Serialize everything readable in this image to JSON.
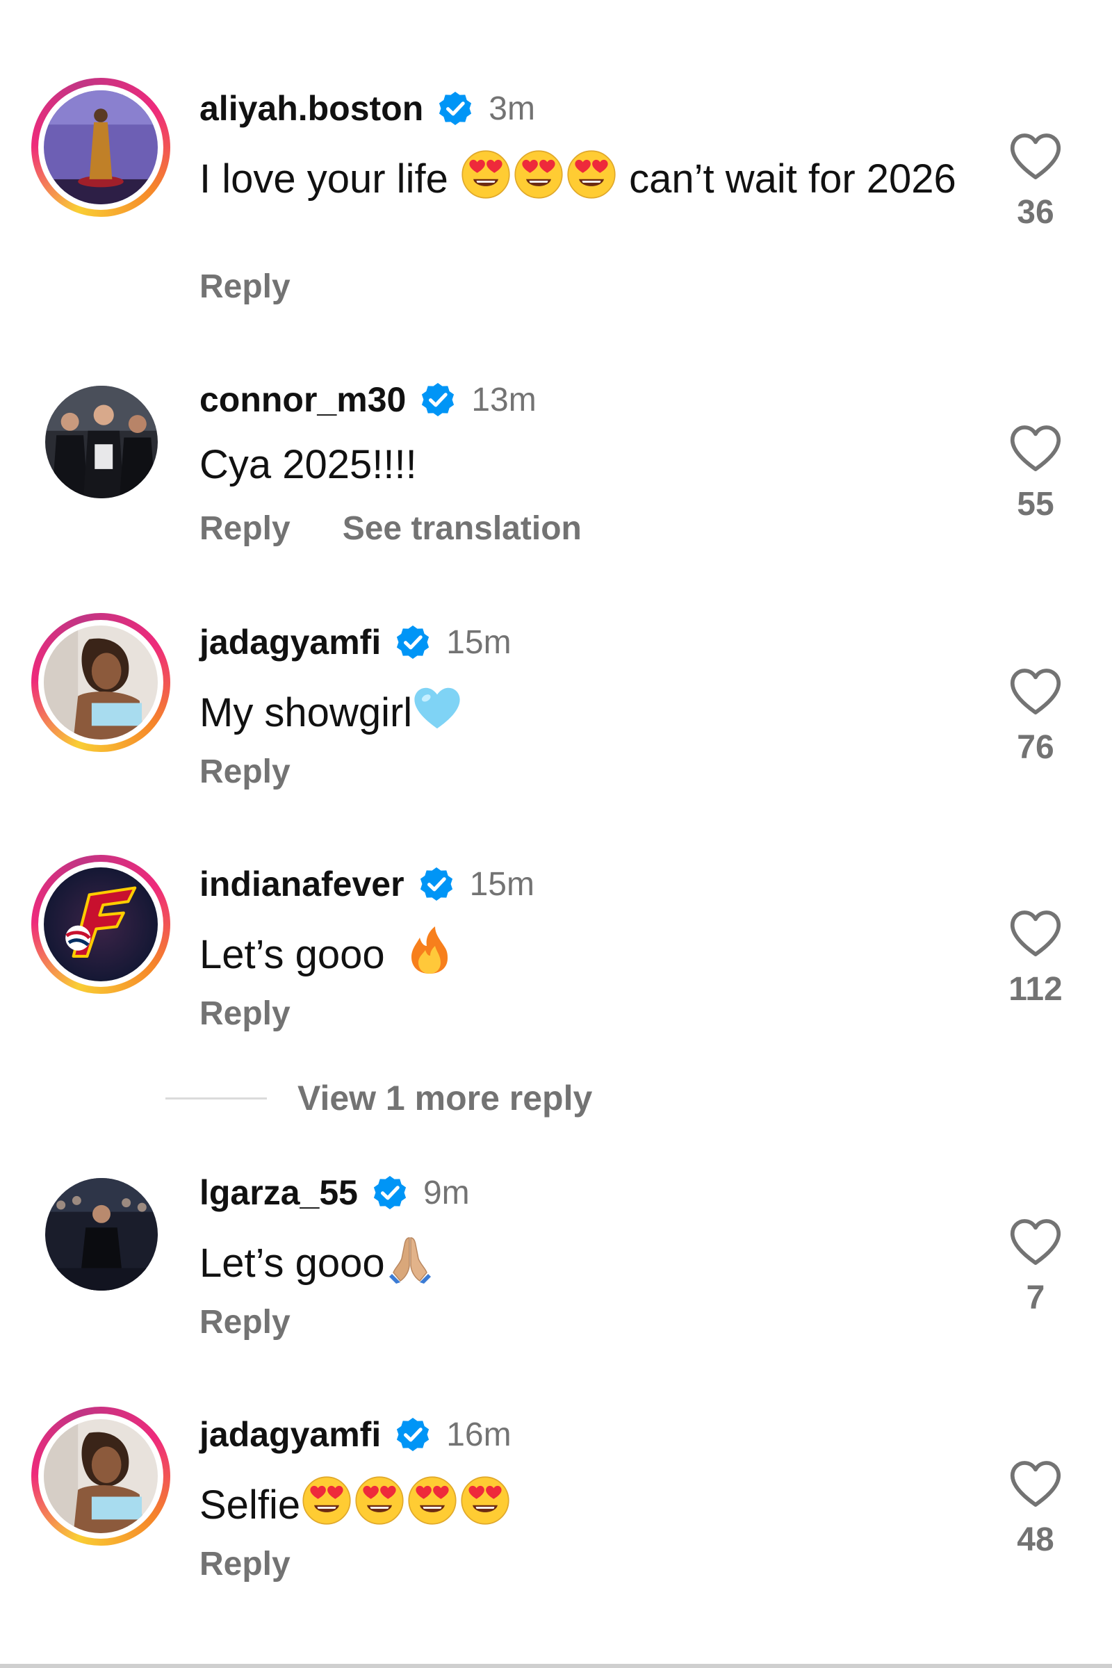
{
  "comments": [
    {
      "username": "aliyah.boston",
      "time": "3m",
      "text_parts": [
        "I love your life ",
        " can’t wait for 2026"
      ],
      "reply_label": "Reply",
      "likes": "36"
    },
    {
      "username": "connor_m30",
      "time": "13m",
      "text": "Cya 2025!!!!",
      "reply_label": "Reply",
      "translation_label": "See translation",
      "likes": "55"
    },
    {
      "username": "jadagyamfi",
      "time": "15m",
      "text": "My showgirl",
      "reply_label": "Reply",
      "likes": "76"
    },
    {
      "username": "indianafever",
      "time": "15m",
      "text": "Let’s gooo",
      "reply_label": "Reply",
      "likes": "112"
    },
    {
      "username": "lgarza_55",
      "time": "9m",
      "text": "Let’s gooo",
      "reply_label": "Reply",
      "likes": "7"
    },
    {
      "username": "jadagyamfi",
      "time": "16m",
      "text": "Selfie",
      "reply_label": "Reply",
      "likes": "48"
    }
  ],
  "view_more_replies": "View 1 more reply",
  "icons": {
    "verified": "verified-badge-icon",
    "like": "heart-outline-icon",
    "emojis": [
      "heart-eyes-emoji",
      "blue-heart-emoji",
      "fire-emoji",
      "folded-hands-emoji"
    ]
  },
  "colors": {
    "verified_blue": "#0095f6",
    "secondary_text": "#737373",
    "story_ring": [
      "#f9ce34",
      "#ee2a7b",
      "#c13584"
    ]
  }
}
